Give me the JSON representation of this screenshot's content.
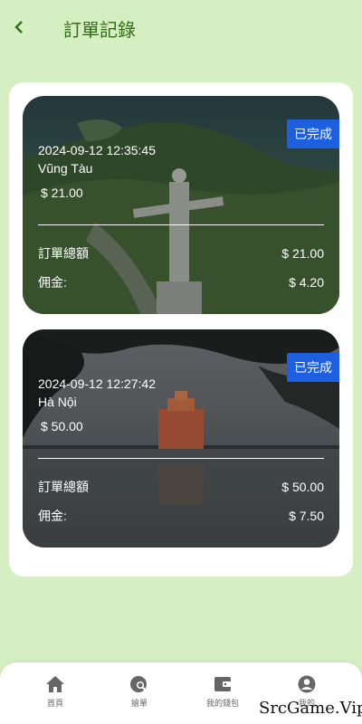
{
  "header": {
    "title": "訂單記錄",
    "back_icon": "chevron-left-icon"
  },
  "orders": [
    {
      "status": "已完成",
      "datetime": "2024-09-12 12:35:45",
      "place": "Vũng Tàu",
      "price": "$ 21.00",
      "total_label": "訂單總額",
      "total_value": "$ 21.00",
      "commission_label": "佣金:",
      "commission_value": "$ 4.20"
    },
    {
      "status": "已完成",
      "datetime": "2024-09-12 12:27:42",
      "place": "Hà Nội",
      "price": "$ 50.00",
      "total_label": "訂單總額",
      "total_value": "$ 50.00",
      "commission_label": "佣金:",
      "commission_value": "$ 7.50"
    }
  ],
  "tabbar": {
    "items": [
      {
        "label": "首頁",
        "icon": "home-icon"
      },
      {
        "label": "搶單",
        "icon": "search-globe-icon"
      },
      {
        "label": "我的錢包",
        "icon": "wallet-icon"
      },
      {
        "label": "我的",
        "icon": "profile-icon"
      }
    ]
  },
  "watermark": "SrcGame.Vip",
  "colors": {
    "accent": "#2f6e16",
    "background": "#d6efc2",
    "status_badge": "#1c5fe0"
  }
}
